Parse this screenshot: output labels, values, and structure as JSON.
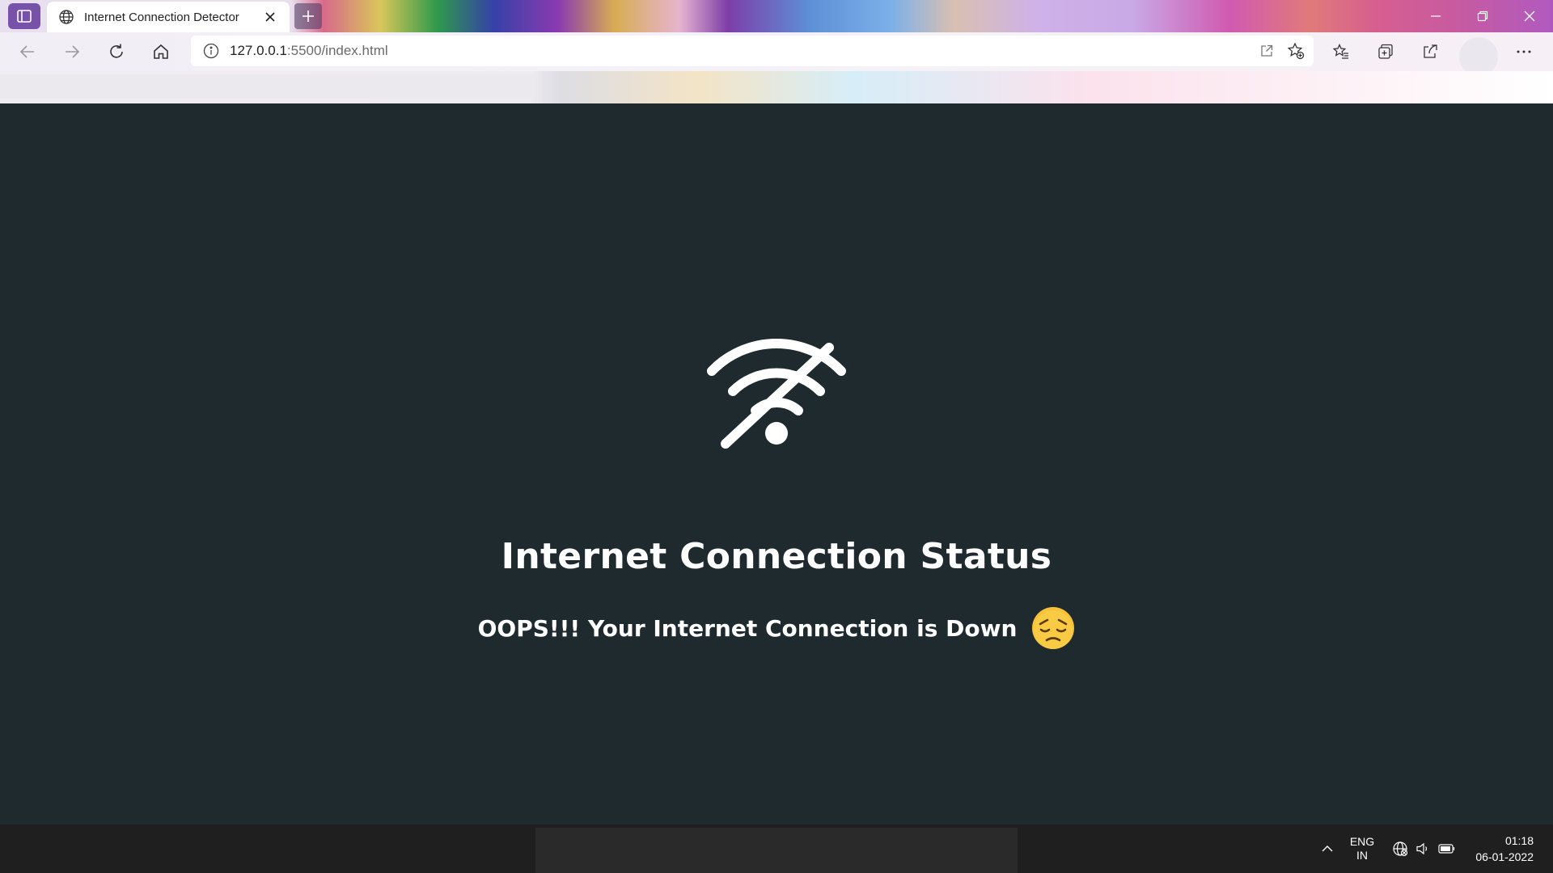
{
  "browser": {
    "tab_title": "Internet Connection Detector",
    "url_host": "127.0.0.1",
    "url_path": ":5500/index.html"
  },
  "icons": {
    "sidebar": "vertical-tabs-icon",
    "tab_favicon": "globe-icon",
    "tab_close": "close-icon",
    "new_tab": "plus-icon",
    "minimize": "minimize-icon",
    "restore": "restore-icon",
    "close_window": "close-icon",
    "back": "back-arrow-icon",
    "forward": "forward-arrow-icon",
    "refresh": "refresh-icon",
    "home": "home-icon",
    "site_info": "info-icon",
    "open_in_app": "open-external-icon",
    "add_favorite": "star-add-icon",
    "favorites": "favorites-list-icon",
    "collections": "collections-icon",
    "share": "share-icon",
    "more": "more-dots-icon",
    "wifi_off": "wifi-off-icon",
    "emoji": "pensive-face-emoji",
    "tray_chevron": "chevron-up-icon",
    "network": "globe-icon",
    "volume": "speaker-icon",
    "battery": "battery-icon"
  },
  "page": {
    "heading": "Internet Connection Status",
    "message": "OOPS!!! Your Internet Connection is Down"
  },
  "taskbar": {
    "lang_line1": "ENG",
    "lang_line2": "IN",
    "time": "01:18",
    "date": "06-01-2022"
  },
  "colors": {
    "page_background": "#1e2a2e",
    "text": "#ffffff",
    "emoji_face": "#f7c138"
  }
}
